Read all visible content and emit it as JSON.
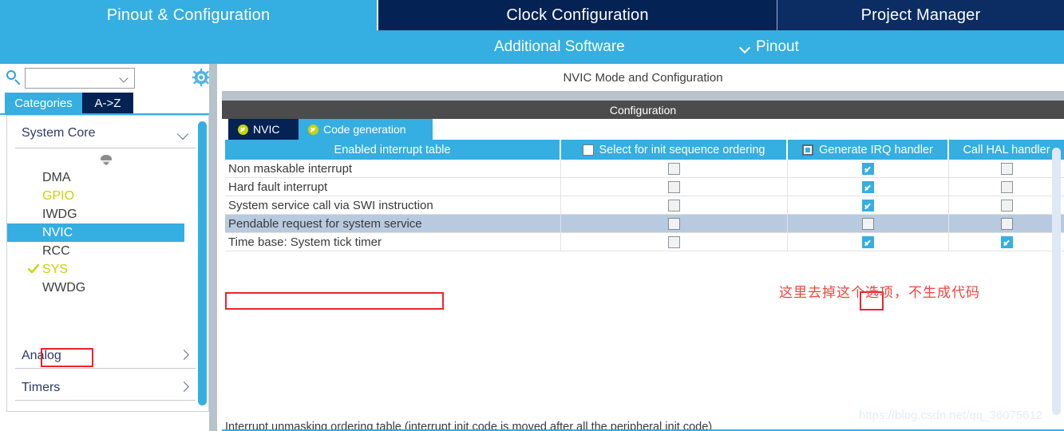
{
  "topnav": {
    "tabs": [
      {
        "label": "Pinout & Configuration",
        "state": "active"
      },
      {
        "label": "Clock Configuration",
        "state": "inactive"
      },
      {
        "label": "Project Manager",
        "state": "inactive"
      }
    ]
  },
  "subnav": {
    "additional_software": "Additional Software",
    "pinout": "Pinout",
    "pinout_chevron": "chevron-down-icon"
  },
  "sidebar": {
    "search": {
      "value": "",
      "placeholder": "",
      "icon": "search-icon"
    },
    "settings_icon": "gear-icon",
    "tabs": [
      {
        "label": "Categories",
        "state": "active"
      },
      {
        "label": "A->Z",
        "state": "inactive"
      }
    ],
    "group": {
      "label": "System Core",
      "chevron": "chevron-down-icon"
    },
    "collapse_icon": "collapse-handle-icon",
    "items": [
      {
        "label": "DMA",
        "color": "normal",
        "selected": false,
        "check": false
      },
      {
        "label": "GPIO",
        "color": "yellow",
        "selected": false,
        "check": false
      },
      {
        "label": "IWDG",
        "color": "normal",
        "selected": false,
        "check": false
      },
      {
        "label": "NVIC",
        "color": "white",
        "selected": true,
        "check": false
      },
      {
        "label": "RCC",
        "color": "normal",
        "selected": false,
        "check": false
      },
      {
        "label": "SYS",
        "color": "yellow",
        "selected": false,
        "check": true
      },
      {
        "label": "WWDG",
        "color": "normal",
        "selected": false,
        "check": false
      }
    ],
    "sections": [
      {
        "label": "Analog",
        "arrow": "chevron-right-icon"
      },
      {
        "label": "Timers",
        "arrow": "chevron-right-icon"
      }
    ]
  },
  "main": {
    "mode_header": "NVIC Mode and Configuration",
    "configuration_bar": "Configuration",
    "tabs": [
      {
        "label": "NVIC",
        "state": "active",
        "icon": "check-circle-icon"
      },
      {
        "label": "Code generation",
        "state": "inactive",
        "icon": "check-circle-icon"
      }
    ],
    "table": {
      "columns": [
        {
          "label": "Enabled interrupt table",
          "checkbox": "none"
        },
        {
          "label": "Select for init sequence ordering",
          "checkbox": "unchecked"
        },
        {
          "label": "Generate IRQ handler",
          "checkbox": "indeterminate"
        },
        {
          "label": "Call HAL handler",
          "checkbox": "none"
        }
      ],
      "rows": [
        {
          "name": "Non maskable interrupt",
          "select_init": false,
          "generate_irq": true,
          "call_hal": false,
          "highlighted": false
        },
        {
          "name": "Hard fault interrupt",
          "select_init": false,
          "generate_irq": true,
          "call_hal": false,
          "highlighted": false
        },
        {
          "name": "System service call via SWI instruction",
          "select_init": false,
          "generate_irq": true,
          "call_hal": false,
          "highlighted": false
        },
        {
          "name": "Pendable request for system service",
          "select_init": false,
          "generate_irq": false,
          "call_hal": false,
          "highlighted": true
        },
        {
          "name": "Time base: System tick timer",
          "select_init": false,
          "generate_irq": true,
          "call_hal": true,
          "highlighted": false
        }
      ]
    },
    "annotation": "这里去掉这个选项，不生成代码",
    "footnote": "Interrupt unmasking ordering table (interrupt init code is moved after all the peripheral init code)"
  },
  "watermark": "https://blog.csdn.net/qq_36075612",
  "colors": {
    "accent_blue": "#35aee2",
    "dark_navy": "#052254",
    "tab_navy": "#0b2d63",
    "config_gray": "#4c4c4c",
    "row_selected": "#b8cadf",
    "annotation_red": "#f2443c",
    "highlight_box_red": "#e8262b",
    "yellow_green": "#c8d400"
  }
}
